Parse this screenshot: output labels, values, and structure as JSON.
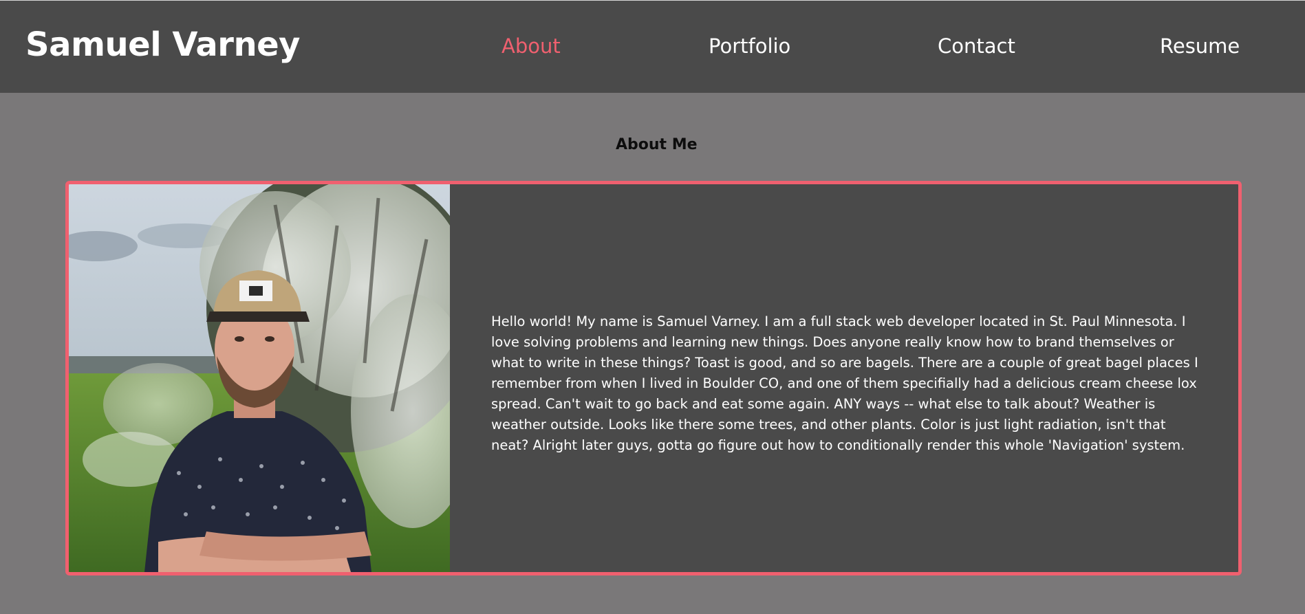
{
  "header": {
    "brand": "Samuel Varney",
    "nav": [
      {
        "label": "About",
        "active": true
      },
      {
        "label": "Portfolio",
        "active": false
      },
      {
        "label": "Contact",
        "active": false
      },
      {
        "label": "Resume",
        "active": false
      }
    ]
  },
  "about": {
    "title": "About Me",
    "photo_icon": "portrait-photo",
    "bio": "Hello world! My name is Samuel Varney. I am a full stack web developer located in St. Paul Minnesota. I love solving problems and learning new things. Does anyone really know how to brand themselves or what to write in these things? Toast is good, and so are bagels. There are a couple of great bagel places I remember from when I lived in Boulder CO, and one of them specifially had a delicious cream cheese lox spread. Can't wait to go back and eat some again. ANY ways -- what else to talk about? Weather is weather outside. Looks like there some trees, and other plants. Color is just light radiation, isn't that neat? Alright later guys, gotta go figure out how to conditionally render this whole 'Navigation' system."
  },
  "colors": {
    "header_bg": "#4a4a4a",
    "page_bg": "#7a7879",
    "accent": "#f0606f",
    "card_bg": "#4a4a4a",
    "text": "#ffffff"
  }
}
